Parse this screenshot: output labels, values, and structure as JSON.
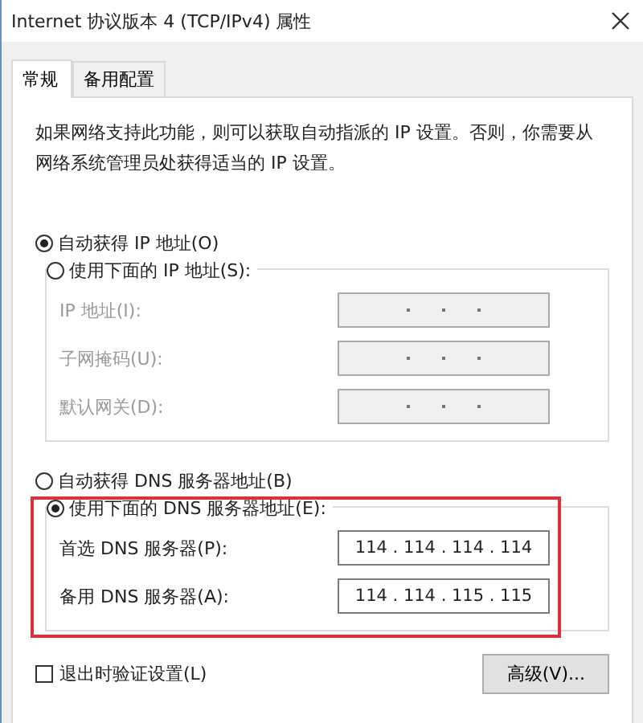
{
  "window": {
    "title": "Internet 协议版本 4 (TCP/IPv4) 属性"
  },
  "tabs": [
    {
      "label": "常规",
      "selected": true
    },
    {
      "label": "备用配置",
      "selected": false
    }
  ],
  "description": "如果网络支持此功能，则可以获取自动指派的 IP 设置。否则，你需要从网络系统管理员处获得适当的 IP 设置。",
  "ip_options": [
    {
      "label": "自动获得 IP 地址(O)",
      "selected": true
    },
    {
      "label": "使用下面的 IP 地址(S):",
      "selected": false
    }
  ],
  "ip_fields": [
    {
      "label": "IP 地址(I):",
      "disabled": true
    },
    {
      "label": "子网掩码(U):",
      "disabled": true
    },
    {
      "label": "默认网关(D):",
      "disabled": true
    }
  ],
  "dns_options": [
    {
      "label": "自动获得 DNS 服务器地址(B)",
      "selected": false
    },
    {
      "label": "使用下面的 DNS 服务器地址(E):",
      "selected": true
    }
  ],
  "dns_fields": [
    {
      "label": "首选 DNS 服务器(P):",
      "value": "114 . 114 . 114 . 114",
      "disabled": false
    },
    {
      "label": "备用 DNS 服务器(A):",
      "value": "114 . 114 . 115 . 115",
      "disabled": false
    }
  ],
  "validate_checkbox": {
    "label": "退出时验证设置(L)",
    "checked": false
  },
  "advanced_button": {
    "label": "高级(V)..."
  }
}
